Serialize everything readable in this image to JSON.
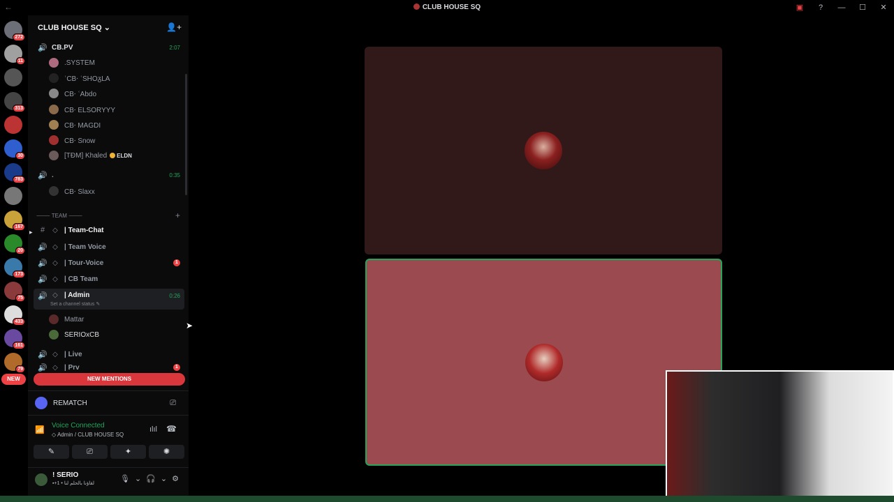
{
  "titlebar": {
    "title": "CLUB HOUSE SQ",
    "back_icon": "←",
    "controls": [
      "▣",
      "?",
      "—",
      "☐",
      "✕"
    ]
  },
  "servers": [
    {
      "badge": "272",
      "color": "#6d6f78"
    },
    {
      "badge": "11",
      "color": "#a0a0a0"
    },
    {
      "badge": "",
      "color": "#555"
    },
    {
      "badge": "313",
      "color": "#444"
    },
    {
      "badge": "",
      "color": "#b33"
    },
    {
      "badge": "30",
      "color": "#2f5fcf"
    },
    {
      "badge": "783",
      "color": "#1a3a8a"
    },
    {
      "badge": "",
      "color": "#777"
    },
    {
      "badge": "167",
      "color": "#c9a23a"
    },
    {
      "badge": "20",
      "color": "#2a8a2a"
    },
    {
      "badge": "173",
      "color": "#3a7aaa"
    },
    {
      "badge": "75",
      "color": "#8a3a3a"
    },
    {
      "badge": "433",
      "color": "#ddd"
    },
    {
      "badge": "161",
      "color": "#6a4aa0"
    },
    {
      "badge": "79",
      "color": "#b06a2a"
    }
  ],
  "new_pill": "NEW",
  "guild": {
    "name": "CLUB HOUSE SQ",
    "dropdown": "⌄",
    "invite_icon": "👤+"
  },
  "channels_top": [
    {
      "label": "CB.PV",
      "time": "2:07"
    }
  ],
  "members_cbpv": [
    {
      "name": ".SYSTEM",
      "color": "#b06a80"
    },
    {
      "name": "ʿCB⸱ ʿSHOᵹLA",
      "color": "#222"
    },
    {
      "name": "CB⸱ ʿAbdo",
      "color": "#888"
    },
    {
      "name": "CB⸱ ELSORYYY",
      "color": "#8a6a4a"
    },
    {
      "name": "CB⸱ MAGDI",
      "color": "#a08050"
    },
    {
      "name": "CB⸱ Snow",
      "color": "#a03030"
    },
    {
      "name": "[TĐM] Khaled",
      "color": "#6a5a5a",
      "tag": "ELDN"
    }
  ],
  "channel_dot": {
    "label": ".",
    "time": "0:35"
  },
  "members_dot": [
    {
      "name": "CB⸱ Slaxx",
      "color": "#333"
    }
  ],
  "category": {
    "label": "⸻ TEAM ⸻",
    "plus": "+"
  },
  "team_channels": [
    {
      "label": "| Team-Chat",
      "type": "text"
    },
    {
      "label": "| Team Voice",
      "type": "voice"
    },
    {
      "label": "| Tour-Voice",
      "type": "voice",
      "mentions": "1"
    },
    {
      "label": "| CB Team",
      "type": "voice"
    },
    {
      "label": "| Admin",
      "type": "voice",
      "time": "0:26",
      "status": "Set a channel status ✎"
    }
  ],
  "members_admin": [
    {
      "name": "Mattar",
      "color": "#5a2a2a"
    },
    {
      "name": "SERIOxCB",
      "color": "#4a6a3a"
    }
  ],
  "more_channels": [
    {
      "label": "| Live"
    },
    {
      "label": "| Prv",
      "mentions": "1"
    }
  ],
  "new_mentions": "NEW MENTIONS",
  "activity": {
    "name": "REMATCH"
  },
  "voice": {
    "status": "Voice Connected",
    "channel": "Admin / CLUB HOUSE SQ"
  },
  "voice_buttons": [
    "✎",
    "⎚",
    "✦",
    "✺"
  ],
  "user": {
    "name": "! SERIO",
    "status": "▪+1 • لقاؤنا بالحلم لنا"
  },
  "user_controls": [
    "🎙",
    "⌄",
    "🎧",
    "⌄",
    "⚙"
  ]
}
